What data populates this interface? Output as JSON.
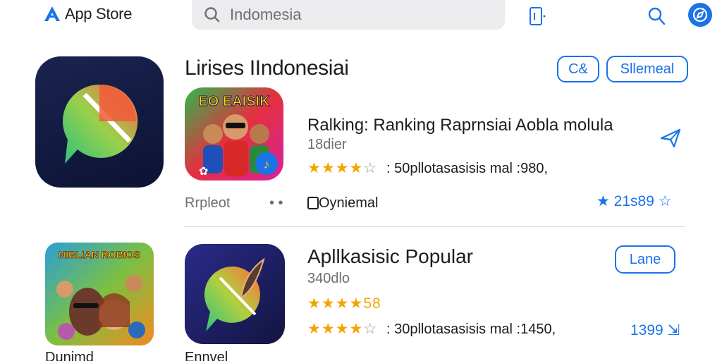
{
  "header": {
    "store_name": "App Store",
    "search_value": "Indomesia"
  },
  "featured": {
    "section_title": "Lirises IIndonesiai",
    "button_share": "C&",
    "button_more": "Sllemeal",
    "bottom_left_label": "Rrpleot",
    "dots": "• •"
  },
  "app1": {
    "name": "Ralking: Ranking  Raprnsiai Aobla molula",
    "sub": "18dier",
    "stars_full": "★★★★",
    "stars_empty": "☆",
    "rating_text": ": 50pllotasasisis mal :980,",
    "category": "Oyniemal",
    "count": "21s89",
    "icon_text": "EO EAISIK"
  },
  "app2": {
    "section_title": "Apllkasisic Popular",
    "sub": "340dlo",
    "stars_partial": "★★★★",
    "stars_partial_text": "58",
    "stars_full": "★★★★",
    "stars_empty": "☆",
    "rating_text": ": 30pllotasasisis mal :1450,",
    "count": "1399",
    "button_label": "Lane"
  },
  "bottom_row": {
    "left_label": "Dunimd",
    "mid_label": "Ennvel",
    "poster_title": "NIBLIAN ROBIOS"
  },
  "colors": {
    "accent": "#1a73e8",
    "star": "#f4a400"
  }
}
